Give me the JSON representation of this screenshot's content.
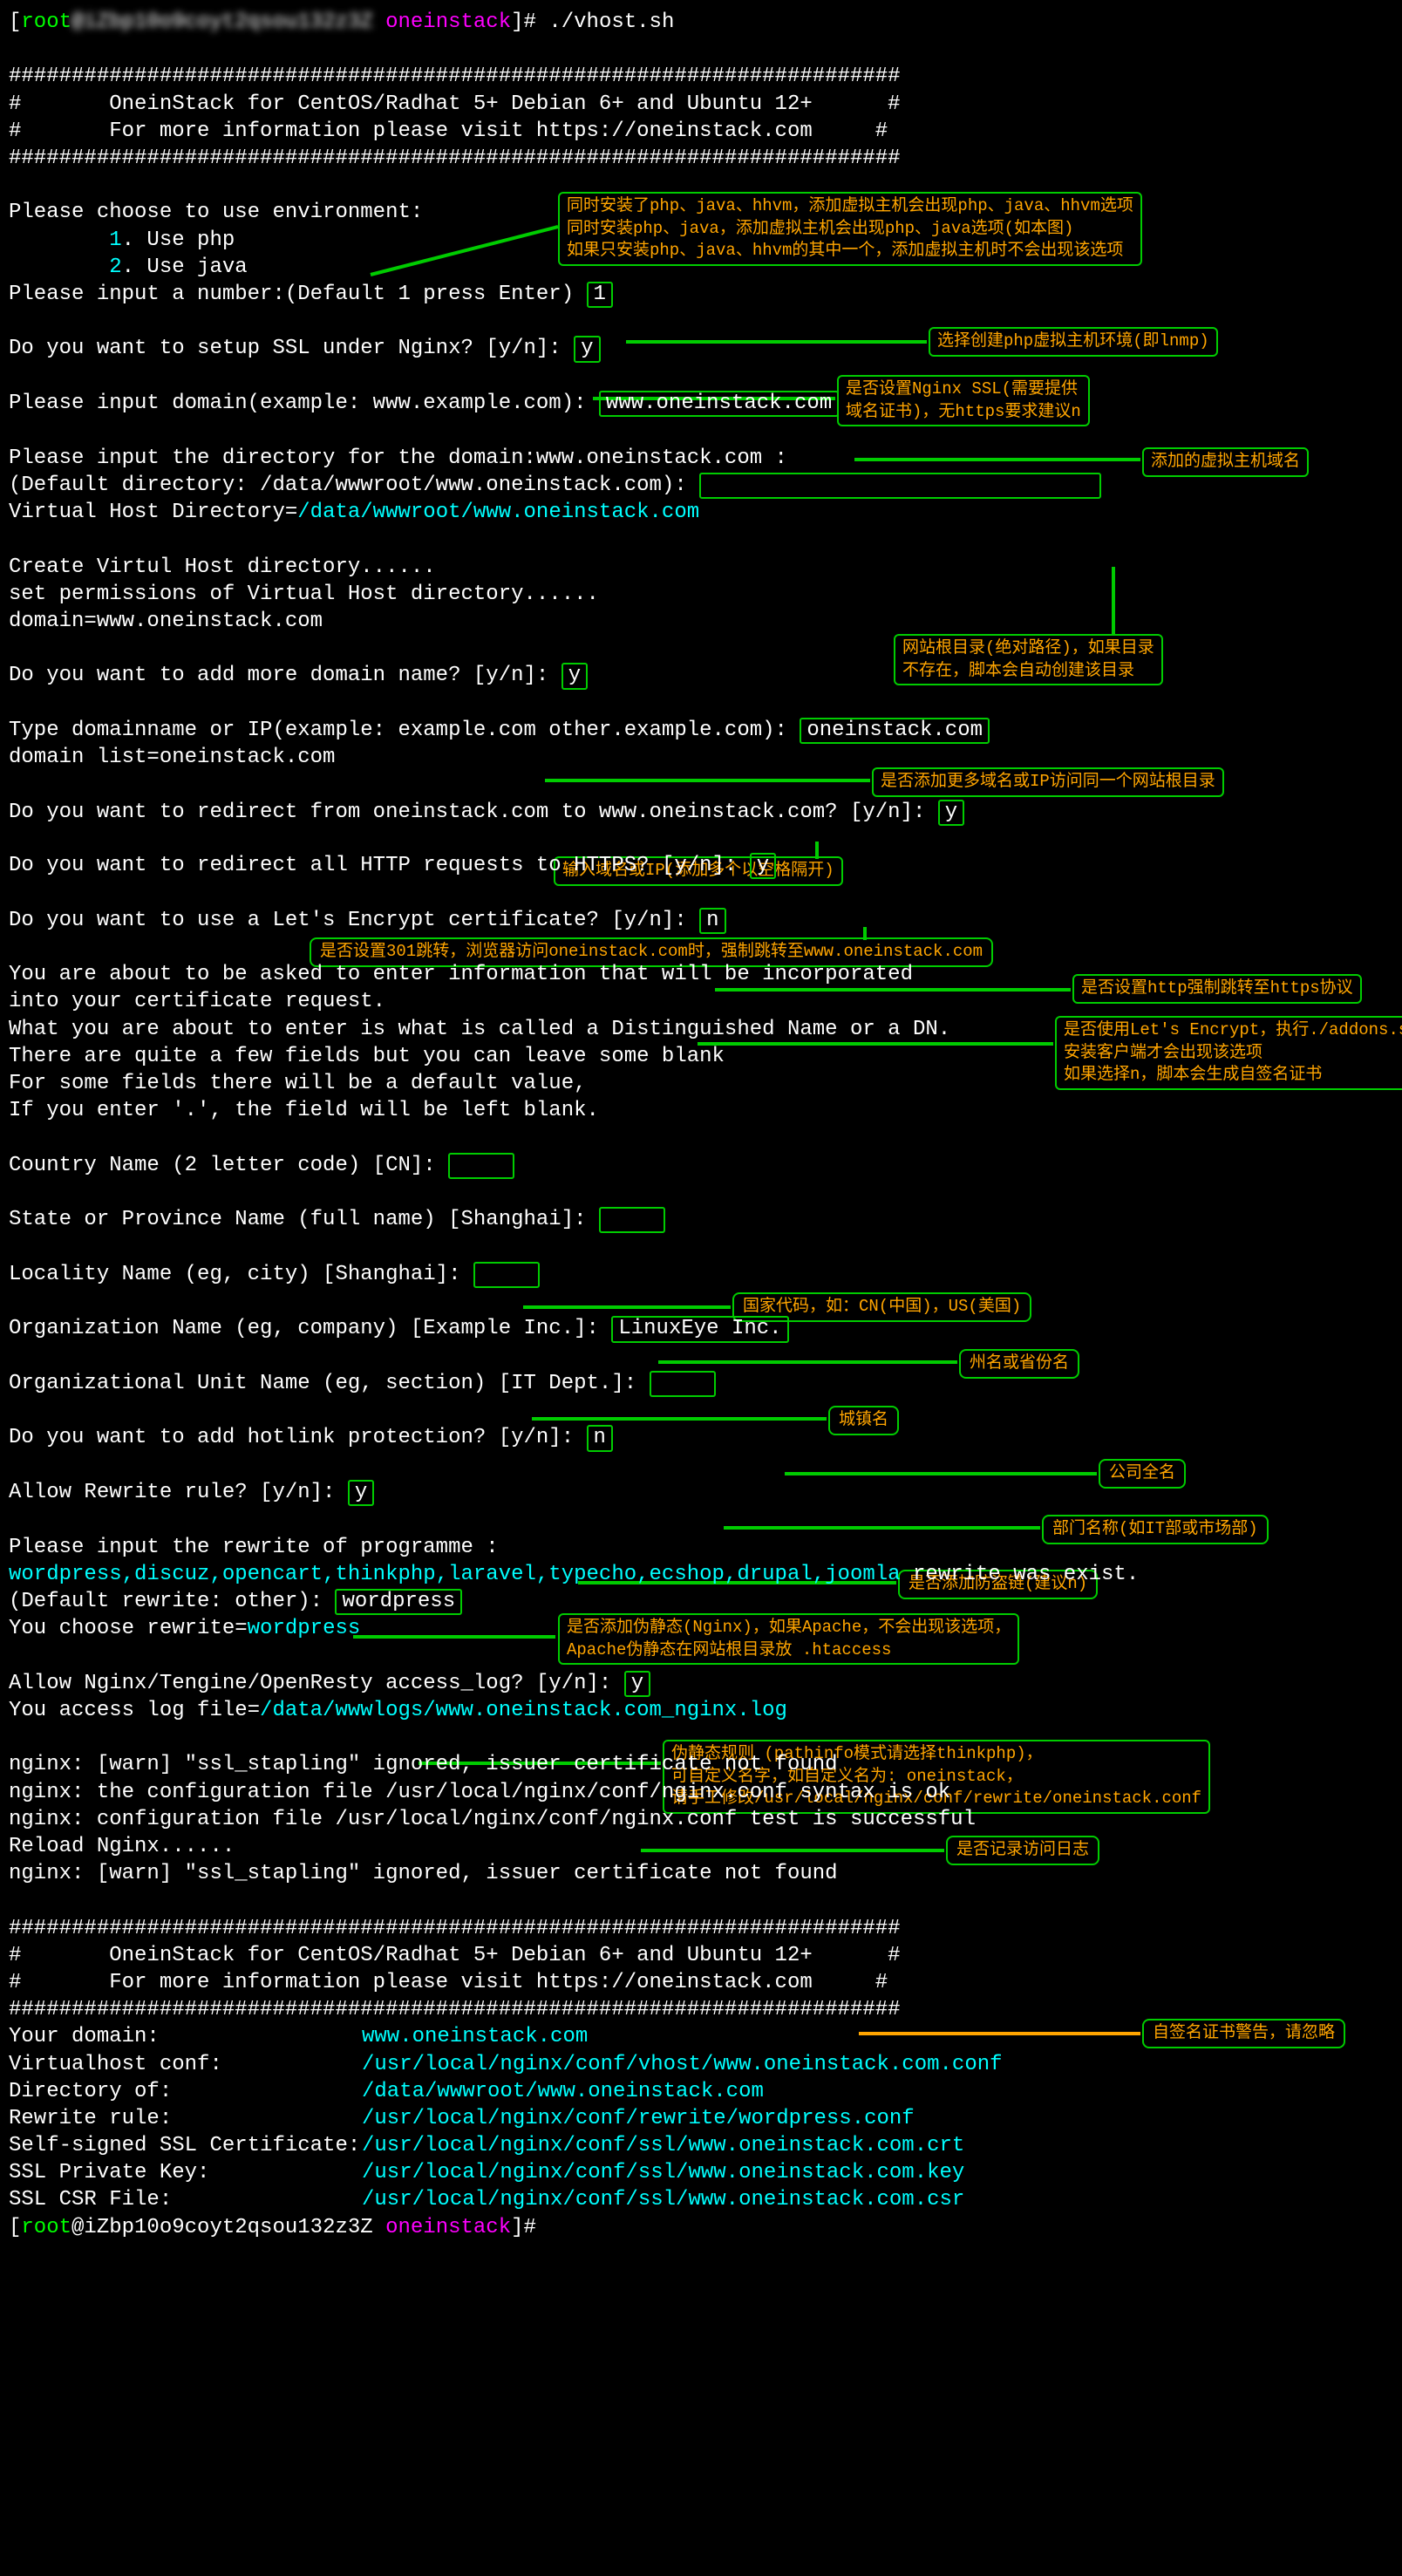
{
  "prompt": {
    "user1": "root",
    "host1_blur": "@iZbp10o9coyt2qsou132z3Z",
    "folder": "oneinstack",
    "cmd": "./vhost.sh",
    "user2": "root",
    "host2": "@iZbp10o9coyt2qsou132z3Z",
    "folder2": "oneinstack",
    "prompt_end": "]#"
  },
  "hash": "#######################################################################",
  "banner": {
    "l1": "#       OneinStack for CentOS/Radhat 5+ Debian 6+ and Ubuntu 12+      #",
    "l2": "#       For more information please visit https://oneinstack.com     #"
  },
  "env": {
    "choose": "Please choose to use environment:",
    "opt1n": "1",
    "opt1l": ". Use php",
    "opt2n": "2",
    "opt2l": ". Use java",
    "input": "Please input a number:(Default 1 press Enter)",
    "val": "1"
  },
  "ssl": {
    "q": "Do you want to setup SSL under Nginx? [y/n]:",
    "v": "y"
  },
  "domain": {
    "q": "Please input domain(example: www.example.com):",
    "v": "www.oneinstack.com"
  },
  "dir": {
    "l1": "Please input the directory for the domain:www.oneinstack.com :",
    "l2a": "(Default directory: /data/wwwroot/www.oneinstack.com):",
    "l2v": " ",
    "l3a": "Virtual Host Directory=",
    "l3b": "/data/wwwroot/www.oneinstack.com"
  },
  "create": {
    "l1": "Create Virtul Host directory......",
    "l2": "set permissions of Virtual Host directory......",
    "l3": "domain=www.oneinstack.com"
  },
  "moredomain": {
    "q": "Do you want to add more domain name? [y/n]:",
    "v": "y",
    "t1": "Type domainname or IP(example: example.com other.example.com):",
    "t1v": "oneinstack.com",
    "t2": "domain list=oneinstack.com"
  },
  "redir": {
    "q1": "Do you want to redirect from oneinstack.com to www.oneinstack.com? [y/n]:",
    "v1": "y",
    "q2": "Do you want to redirect all HTTP requests to HTTPS? [y/n]:",
    "v2": "y"
  },
  "le": {
    "q": "Do you want to use a Let's Encrypt certificate? [y/n]:",
    "v": "n"
  },
  "cert": {
    "l1": "You are about to be asked to enter information that will be incorporated",
    "l2": "into your certificate request.",
    "l3": "What you are about to enter is what is called a Distinguished Name or a DN.",
    "l4": "There are quite a few fields but you can leave some blank",
    "l5": "For some fields there will be a default value,",
    "l6": "If you enter '.', the field will be left blank."
  },
  "dn": {
    "cnq": "Country Name (2 letter code) [CN]:",
    "cnv": "  ",
    "stq": "State or Province Name (full name) [Shanghai]:",
    "stv": "  ",
    "lq": "Locality Name (eg, city) [Shanghai]:",
    "lv": "  ",
    "oq": "Organization Name (eg, company) [Example Inc.]:",
    "ov": "LinuxEye Inc.",
    "ouq": "Organizational Unit Name (eg, section) [IT Dept.]:",
    "ouv": "  "
  },
  "hotlink": {
    "q": "Do you want to add hotlink protection? [y/n]:",
    "v": "n"
  },
  "rewrite": {
    "q": "Allow Rewrite rule? [y/n]:",
    "v": "y",
    "p1": "Please input the rewrite of programme :",
    "list": "wordpress,discuz,opencart,thinkphp,laravel,typecho,ecshop,drupal,joomla",
    "suffix": " rewrite was exist.",
    "d1a": "(Default rewrite: other):",
    "d1v": "wordpress",
    "d2a": "You choose rewrite=",
    "d2b": "wordpress"
  },
  "accesslog": {
    "q": "Allow Nginx/Tengine/OpenResty access_log? [y/n]:",
    "v": "y",
    "l2a": "You access log file=",
    "l2b": "/data/wwwlogs/www.oneinstack.com_nginx.log"
  },
  "nginx": {
    "l1": "nginx: [warn] \"ssl_stapling\" ignored, issuer certificate not found",
    "l2": "nginx: the configuration file /usr/local/nginx/conf/nginx.conf syntax is ok",
    "l3": "nginx: configuration file /usr/local/nginx/conf/nginx.conf test is successful",
    "l4": "Reload Nginx......",
    "l5": "nginx: [warn] \"ssl_stapling\" ignored, issuer certificate not found"
  },
  "summary": {
    "s1a": "Your domain:",
    "s1b": "www.oneinstack.com",
    "s2a": "Virtualhost conf:",
    "s2b": "/usr/local/nginx/conf/vhost/www.oneinstack.com.conf",
    "s3a": "Directory of:",
    "s3b": "/data/wwwroot/www.oneinstack.com",
    "s4a": "Rewrite rule:",
    "s4b": "/usr/local/nginx/conf/rewrite/wordpress.conf",
    "s5a": "Self-signed SSL Certificate:",
    "s5b": "/usr/local/nginx/conf/ssl/www.oneinstack.com.crt",
    "s6a": "SSL Private Key:",
    "s6b": "/usr/local/nginx/conf/ssl/www.oneinstack.com.key",
    "s7a": "SSL CSR File:",
    "s7b": "/usr/local/nginx/conf/ssl/www.oneinstack.com.csr"
  },
  "hints": {
    "env": "同时安装了php、java、hhvm，添加虚拟主机会出现php、java、hhvm选项\n同时安装php、java，添加虚拟主机会出现php、java选项(如本图)\n如果只安装php、java、hhvm的其中一个，添加虚拟主机时不会出现该选项",
    "choose_env": "选择创建php虚拟主机环境(即lnmp)",
    "ssl": "是否设置Nginx SSL(需要提供\n域名证书)，无https要求建议n",
    "domain": "添加的虚拟主机域名",
    "dir": "网站根目录(绝对路径)，如果目录\n不存在，脚本会自动创建该目录",
    "moredomain": "是否添加更多域名或IP访问同一个网站根目录",
    "typedomain": "输入域名或IP(添加多个以空格隔开)",
    "redir1": "是否设置301跳转，浏览器访问oneinstack.com时，强制跳转至www.oneinstack.com",
    "redir2": "是否设置http强制跳转至https协议",
    "le": "是否使用Let's Encrypt，执行./addons.sh\n安装客户端才会出现该选项\n如果选择n，脚本会生成自签名证书",
    "cn": "国家代码，如：CN(中国)，US(美国)",
    "st": "州名或省份名",
    "loc": "城镇名",
    "org": "公司全名",
    "ou": "部门名称(如IT部或市场部)",
    "hotlink": "是否添加防盗链(建议n)",
    "rewrite": "是否添加伪静态(Nginx)，如果Apache，不会出现该选项，\nApache伪静态在网站根目录放 .htaccess",
    "rewrite2": "伪静态规则 (pathinfo模式请选择thinkphp)，\n可自定义名字，如自定义名为: oneinstack，\n请手工修改/usr/local/nginx/conf/rewrite/oneinstack.conf",
    "accesslog": "是否记录访问日志",
    "selfsign": "自签名证书警告，请忽略"
  }
}
